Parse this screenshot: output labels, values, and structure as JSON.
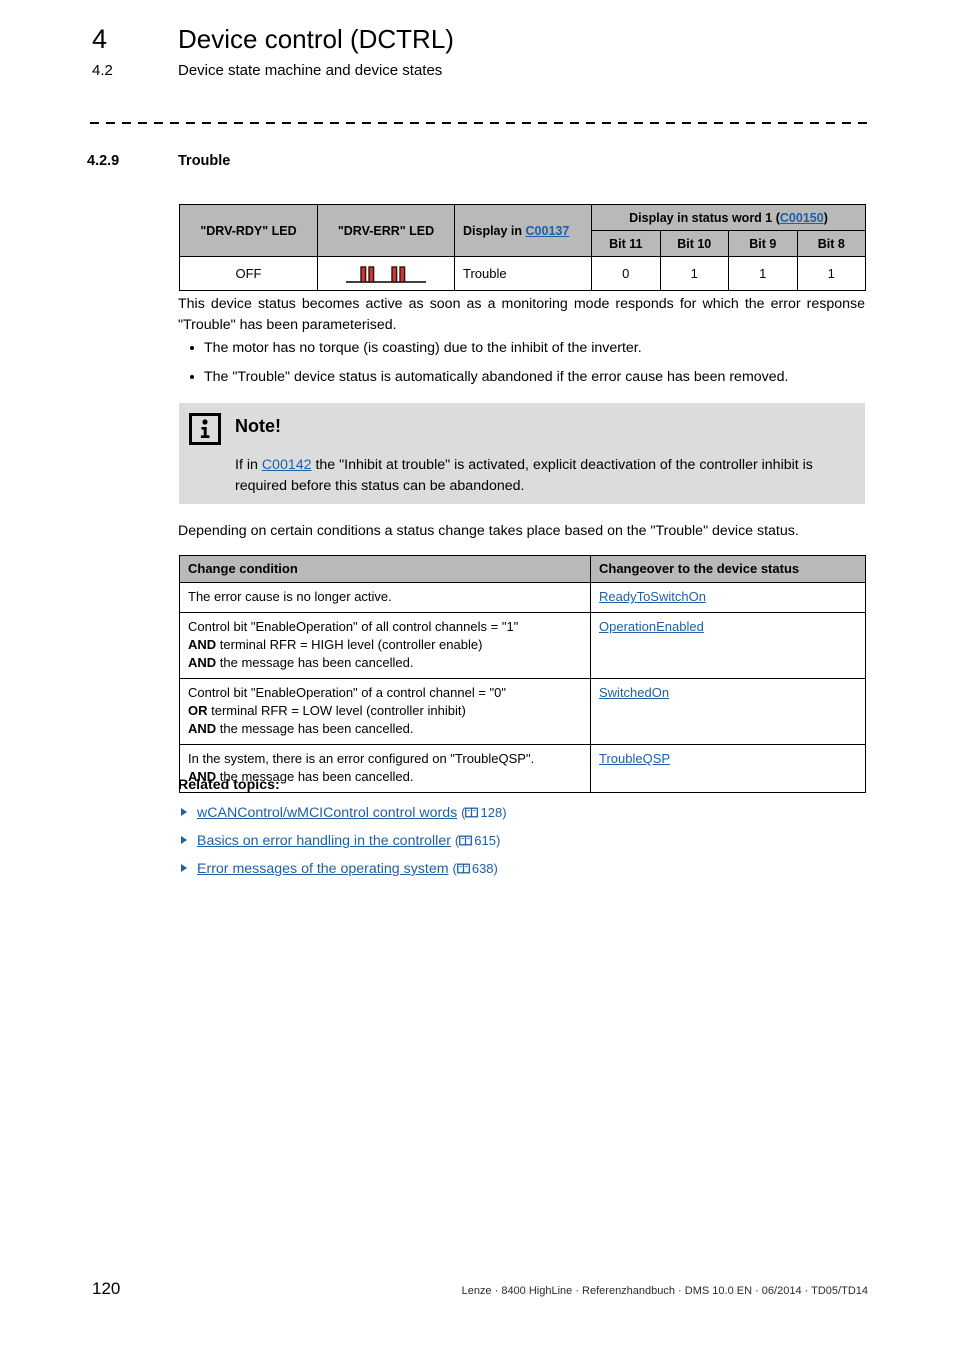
{
  "header": {
    "chapter_number": "4",
    "chapter_title": "Device control (DCTRL)",
    "section_number": "4.2",
    "section_title": "Device state machine and device states"
  },
  "section": {
    "number": "4.2.9",
    "title": "Trouble"
  },
  "status_table": {
    "headers": {
      "drv_rdy": "\"DRV-RDY\" LED",
      "drv_err": "\"DRV-ERR\" LED",
      "display_in_prefix": "Display in ",
      "display_in_code": "C00137",
      "status_word_prefix": "Display in status word 1 (",
      "status_word_code": "C00150",
      "status_word_suffix": ")"
    },
    "bit_headers": [
      "Bit 11",
      "Bit 10",
      "Bit 9",
      "Bit 8"
    ],
    "row": {
      "drv_rdy": "OFF",
      "drv_err_icon": "led-blink-double-pulse-icon",
      "display_in": "Trouble",
      "bits": [
        "0",
        "1",
        "1",
        "1"
      ]
    }
  },
  "intro_paragraph": "This device status becomes active as soon as a monitoring mode responds for which the error response \"Trouble\" has been parameterised.",
  "bullets": [
    "The motor has no torque (is coasting) due to the inhibit of the inverter.",
    "The \"Trouble\" device status is automatically abandoned if the error cause has been removed."
  ],
  "note": {
    "icon": "info-icon",
    "title": "Note!",
    "text_before_link": "If in ",
    "link": "C00142",
    "text_after_link": " the \"Inhibit at trouble\" is activated, explicit deactivation of the controller inhibit is required before this status can be abandoned."
  },
  "depending_paragraph": "Depending on certain conditions a status change takes place based on the \"Trouble\" device status.",
  "change_table": {
    "headers": [
      "Change condition",
      "Changeover to the device status"
    ],
    "rows": [
      {
        "condition_lines": [
          {
            "bold_prefix": "",
            "text": "The error cause is no longer active."
          }
        ],
        "changeover": "ReadyToSwitchOn"
      },
      {
        "condition_lines": [
          {
            "bold_prefix": "",
            "text": "Control bit \"EnableOperation\" of all control channels = \"1\""
          },
          {
            "bold_prefix": "AND",
            "text": " terminal RFR = HIGH level (controller enable)"
          },
          {
            "bold_prefix": "AND",
            "text": " the message has been cancelled."
          }
        ],
        "changeover": "OperationEnabled"
      },
      {
        "condition_lines": [
          {
            "bold_prefix": "",
            "text": "Control bit \"EnableOperation\" of a control channel = \"0\""
          },
          {
            "bold_prefix": "OR",
            "text": " terminal RFR = LOW level (controller inhibit)"
          },
          {
            "bold_prefix": "AND",
            "text": " the message has been cancelled."
          }
        ],
        "changeover": "SwitchedOn"
      },
      {
        "condition_lines": [
          {
            "bold_prefix": "",
            "text": "In the system, there is an error configured on \"TroubleQSP\"."
          },
          {
            "bold_prefix": "AND",
            "text": " the message has been cancelled."
          }
        ],
        "changeover": "TroubleQSP"
      }
    ]
  },
  "related": {
    "title": "Related topics:",
    "items": [
      {
        "label": "wCANControl/wMCIControl control words",
        "page": "128"
      },
      {
        "label": "Basics on error handling in the controller",
        "page": "615"
      },
      {
        "label": "Error messages of the operating system",
        "page": "638"
      }
    ]
  },
  "footer": {
    "page_number": "120",
    "text": "Lenze · 8400 HighLine · Referenzhandbuch · DMS 10.0 EN · 06/2014 · TD05/TD14"
  },
  "colors": {
    "table_header_gray": "#b9b9b9",
    "note_background": "#dcdcdc",
    "link_blue": "#1f5fa8",
    "led_red": "#e03131"
  }
}
